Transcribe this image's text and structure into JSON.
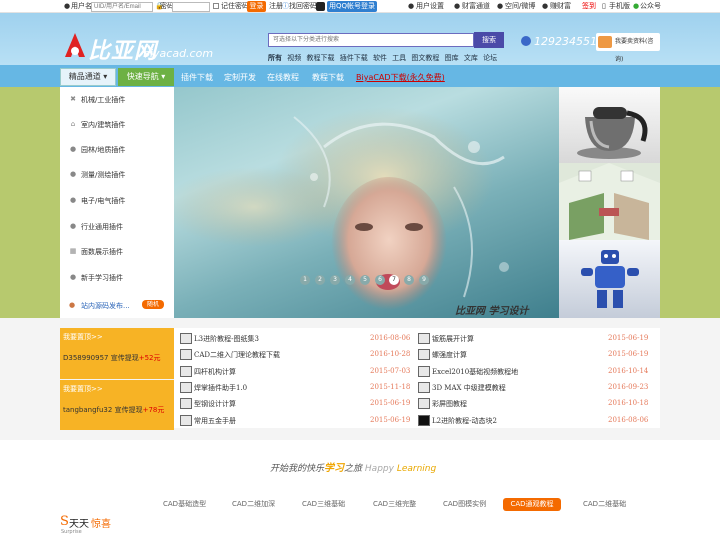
{
  "topbar": {
    "user_label": "用户名",
    "user_placeholder": "UID/用户名/Email",
    "pwd_label": "密码",
    "remember": "记住密码",
    "login": "登录",
    "register": "注册",
    "find_pwd": "找回密码",
    "qq_login": "用QQ帐号登录",
    "user_settings": "用户设置",
    "wealth": "财富通道",
    "space": "空间/微博",
    "earn": "赚财富",
    "checkin": "签到",
    "mobile": "手机版",
    "public": "公众号"
  },
  "header": {
    "logo": "比亚网",
    "url": "biyacad.com",
    "search_placeholder": "可选择以下分类进行搜索",
    "search_button": "搜索",
    "categories": [
      "所有",
      "视频",
      "教程下载",
      "插件下载",
      "软件",
      "工具",
      "图文教程",
      "图库",
      "文库",
      "论坛"
    ],
    "phone": "129234551",
    "qq_badge": "我要卖资料(咨询)"
  },
  "nav": {
    "all": "精品通道",
    "quick": "快速导航",
    "links": [
      "插件下载",
      "定制开发",
      "在线教程",
      "教程下载"
    ],
    "promo": "BiyaCAD下载(永久免费)"
  },
  "sidebar": {
    "items": [
      {
        "label": "机械/工业插件",
        "icon": "wrench-icon"
      },
      {
        "label": "室内/建筑插件",
        "icon": "home-icon"
      },
      {
        "label": "园林/地质插件",
        "icon": "person-icon"
      },
      {
        "label": "测量/测绘插件",
        "icon": "person-icon"
      },
      {
        "label": "电子/电气插件",
        "icon": "person-icon"
      },
      {
        "label": "行业通用插件",
        "icon": "person-icon"
      },
      {
        "label": "面数展示插件",
        "icon": "grid-icon"
      },
      {
        "label": "新手学习插件",
        "icon": "person-icon"
      }
    ],
    "source_label": "站内源码发布...",
    "source_badge": "随机"
  },
  "banner": {
    "dots": [
      "1",
      "2",
      "3",
      "4",
      "5",
      "6",
      "7",
      "8",
      "9"
    ],
    "active_dot": 6,
    "caption": "比亚网 学习设计"
  },
  "notices": [
    {
      "title": "我要置顶>>",
      "user": "D358990957",
      "text": "宣传提现",
      "amount": "+52元"
    },
    {
      "title": "我要置顶>>",
      "user": "tangbangfu32",
      "text": "宣传提现",
      "amount": "+78元"
    }
  ],
  "list_left": [
    {
      "title": "L3进阶教程-图纸集3",
      "date": "2016-08-06"
    },
    {
      "title": "CAD二维入门理论教程下载",
      "date": "2016-10-28"
    },
    {
      "title": "四杆机构计算",
      "date": "2015-07-03"
    },
    {
      "title": "焊掌插件助手1.0",
      "date": "2015-11-18"
    },
    {
      "title": "型钢设计计算",
      "date": "2015-06-19"
    },
    {
      "title": "常用五金手册",
      "date": "2015-06-19"
    }
  ],
  "list_right": [
    {
      "title": "钣筋展开计算",
      "date": "2015-06-19"
    },
    {
      "title": "螺强度计算",
      "date": "2015-06-19"
    },
    {
      "title": "Excel2010基础视频教程地",
      "date": "2016-10-14"
    },
    {
      "title": "3D MAX 中级建模教程",
      "date": "2016-09-23"
    },
    {
      "title": "彩屏图教程",
      "date": "2016-10-18"
    },
    {
      "title": "L2进阶教程-动态块2",
      "date": "2016-08-06"
    }
  ],
  "bottom": {
    "slogan_pre": "开始我的快乐",
    "slogan_hl": "学习",
    "slogan_mid": "之旅",
    "slogan_en1": "Happy",
    "slogan_en2": "Learning",
    "tabs": [
      "CAD基础造型",
      "CAD二维加深",
      "CAD三维基础",
      "CAD三维完整",
      "CAD图模实例",
      "CAD通观教程",
      "CAD二维基础"
    ],
    "active_tab": "CAD通观教程",
    "daily_s": "S",
    "daily_t1": "天天",
    "daily_t2": "惊喜",
    "daily_sub": "Surprise"
  },
  "colors": {
    "nav_blue": "#66b7e4",
    "quick_green": "#6db144",
    "notice_orange": "#f7b325",
    "accent_orange": "#f46a00",
    "date_color": "#e5795a"
  }
}
